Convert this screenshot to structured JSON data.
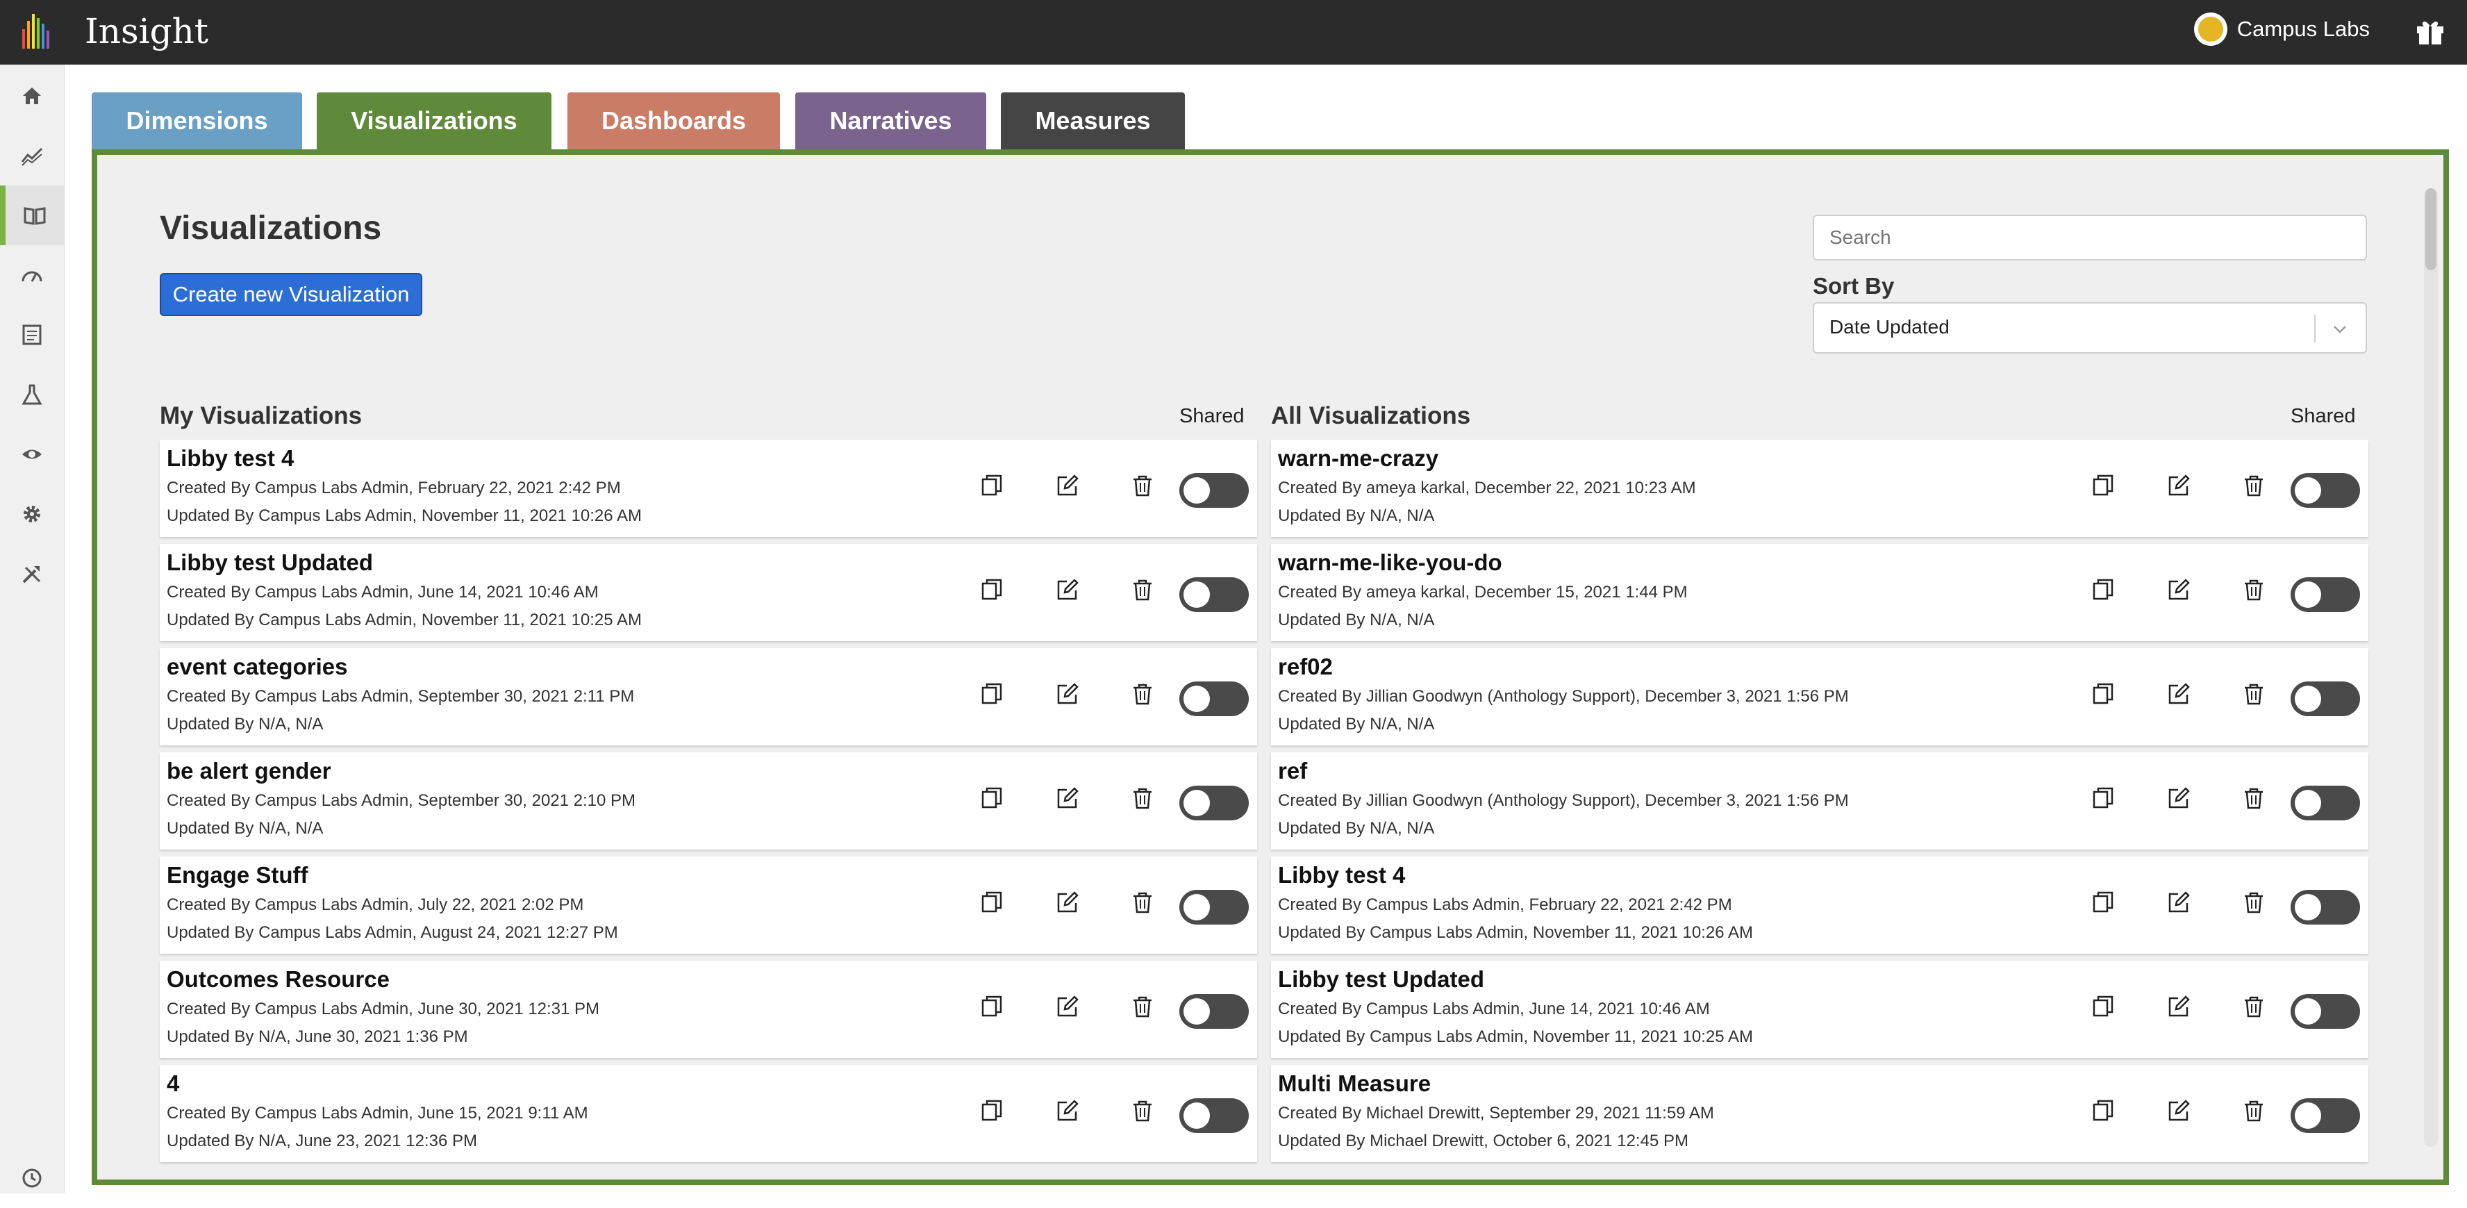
{
  "app": {
    "title": "Insight",
    "org_name": "Campus Labs"
  },
  "rail": [
    "home-icon",
    "trend-icon",
    "book-icon",
    "gauge-icon",
    "document-icon",
    "flask-icon",
    "eye-icon",
    "gear-icon",
    "tools-icon",
    "history-icon"
  ],
  "tabs": [
    {
      "label": "Dimensions",
      "color": "#6a9fc6"
    },
    {
      "label": "Visualizations",
      "color": "#5e8a3a"
    },
    {
      "label": "Dashboards",
      "color": "#c97c66"
    },
    {
      "label": "Narratives",
      "color": "#7a648e"
    },
    {
      "label": "Measures",
      "color": "#454545"
    }
  ],
  "main": {
    "title": "Visualizations",
    "create_label": "Create new Visualization",
    "search_placeholder": "Search",
    "sort_label": "Sort By",
    "sort_value": "Date Updated",
    "my": {
      "title": "My Visualizations",
      "shared_label": "Shared",
      "items": [
        {
          "name": "Libby test 4",
          "created": "Created By Campus Labs Admin, February 22, 2021 2:42 PM",
          "updated": "Updated By Campus Labs Admin, November 11, 2021 10:26 AM"
        },
        {
          "name": "Libby test Updated",
          "created": "Created By Campus Labs Admin, June 14, 2021 10:46 AM",
          "updated": "Updated By Campus Labs Admin, November 11, 2021 10:25 AM"
        },
        {
          "name": "event categories",
          "created": "Created By Campus Labs Admin, September 30, 2021 2:11 PM",
          "updated": "Updated By N/A, N/A"
        },
        {
          "name": "be alert gender",
          "created": "Created By Campus Labs Admin, September 30, 2021 2:10 PM",
          "updated": "Updated By N/A, N/A"
        },
        {
          "name": "Engage Stuff",
          "created": "Created By Campus Labs Admin, July 22, 2021 2:02 PM",
          "updated": "Updated By Campus Labs Admin, August 24, 2021 12:27 PM"
        },
        {
          "name": "Outcomes Resource",
          "created": "Created By Campus Labs Admin, June 30, 2021 12:31 PM",
          "updated": "Updated By N/A, June 30, 2021 1:36 PM"
        },
        {
          "name": "4",
          "created": "Created By Campus Labs Admin, June 15, 2021 9:11 AM",
          "updated": "Updated By N/A, June 23, 2021 12:36 PM"
        }
      ]
    },
    "all": {
      "title": "All Visualizations",
      "shared_label": "Shared",
      "items": [
        {
          "name": "warn-me-crazy",
          "created": "Created By ameya karkal, December 22, 2021 10:23 AM",
          "updated": "Updated By N/A, N/A"
        },
        {
          "name": "warn-me-like-you-do",
          "created": "Created By ameya karkal, December 15, 2021 1:44 PM",
          "updated": "Updated By N/A, N/A"
        },
        {
          "name": "ref02",
          "created": "Created By Jillian Goodwyn (Anthology Support), December 3, 2021 1:56 PM",
          "updated": "Updated By N/A, N/A"
        },
        {
          "name": "ref",
          "created": "Created By Jillian Goodwyn (Anthology Support), December 3, 2021 1:56 PM",
          "updated": "Updated By N/A, N/A"
        },
        {
          "name": "Libby test 4",
          "created": "Created By Campus Labs Admin, February 22, 2021 2:42 PM",
          "updated": "Updated By Campus Labs Admin, November 11, 2021 10:26 AM"
        },
        {
          "name": "Libby test Updated",
          "created": "Created By Campus Labs Admin, June 14, 2021 10:46 AM",
          "updated": "Updated By Campus Labs Admin, November 11, 2021 10:25 AM"
        },
        {
          "name": "Multi Measure",
          "created": "Created By Michael Drewitt, September 29, 2021 11:59 AM",
          "updated": "Updated By Michael Drewitt, October 6, 2021 12:45 PM"
        }
      ]
    }
  }
}
